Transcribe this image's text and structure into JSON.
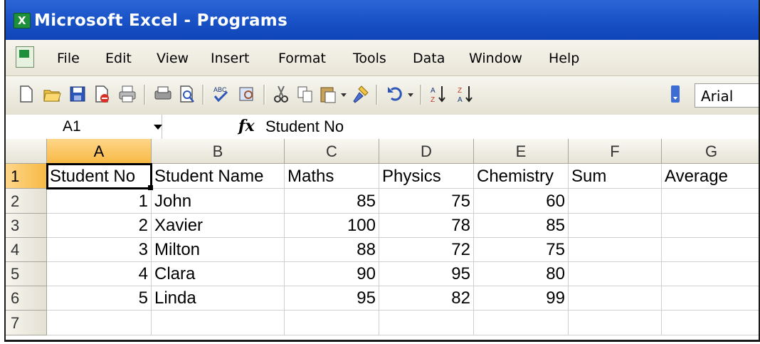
{
  "window": {
    "title": "Microsoft Excel - Programs"
  },
  "menu": [
    "File",
    "Edit",
    "View",
    "Insert",
    "Format",
    "Tools",
    "Data",
    "Window",
    "Help"
  ],
  "toolbar": {
    "font": "Arial"
  },
  "formula_bar": {
    "name_box": "A1",
    "fx_label": "fx",
    "value": "Student No"
  },
  "columns": [
    "A",
    "B",
    "C",
    "D",
    "E",
    "F",
    "G"
  ],
  "rows": [
    "1",
    "2",
    "3",
    "4",
    "5",
    "6",
    "7"
  ],
  "cells": [
    [
      "Student No",
      "Student Name",
      "Maths",
      "Physics",
      "Chemistry",
      "Sum",
      "Average"
    ],
    [
      "1",
      "John",
      "85",
      "75",
      "60",
      "",
      ""
    ],
    [
      "2",
      "Xavier",
      "100",
      "78",
      "85",
      "",
      ""
    ],
    [
      "3",
      "Milton",
      "88",
      "72",
      "75",
      "",
      ""
    ],
    [
      "4",
      "Clara",
      "90",
      "95",
      "80",
      "",
      ""
    ],
    [
      "5",
      "Linda",
      "95",
      "82",
      "99",
      "",
      ""
    ],
    [
      "",
      "",
      "",
      "",
      "",
      "",
      ""
    ]
  ],
  "selected_cell": "A1",
  "colors": {
    "title_bar": "#1b54c9",
    "header_active": "#f7b944"
  }
}
